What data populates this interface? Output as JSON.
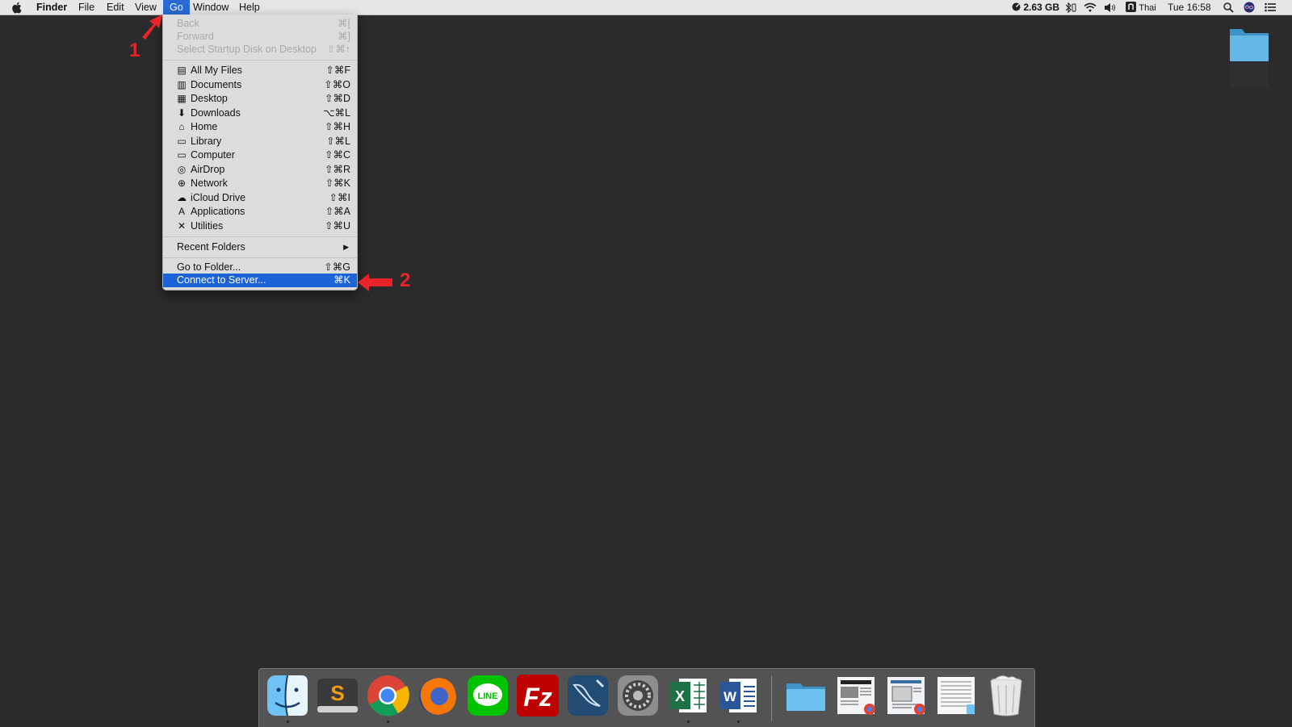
{
  "menubar": {
    "apple_icon": "apple-logo-icon",
    "app_name": "Finder",
    "items": [
      "File",
      "Edit",
      "View",
      "Go",
      "Window",
      "Help"
    ],
    "active_item": "Go",
    "status": {
      "memory": "2.63 GB",
      "input_source": "Thai",
      "clock": "Tue 16:58"
    }
  },
  "go_menu": {
    "nav": [
      {
        "label": "Back",
        "shortcut": "⌘[",
        "enabled": false
      },
      {
        "label": "Forward",
        "shortcut": "⌘]",
        "enabled": false
      },
      {
        "label": "Select Startup Disk on Desktop",
        "shortcut": "⇧⌘↑",
        "enabled": false
      }
    ],
    "places": [
      {
        "label": "All My Files",
        "shortcut": "⇧⌘F",
        "icon": "all-files-icon"
      },
      {
        "label": "Documents",
        "shortcut": "⇧⌘O",
        "icon": "documents-icon"
      },
      {
        "label": "Desktop",
        "shortcut": "⇧⌘D",
        "icon": "desktop-icon"
      },
      {
        "label": "Downloads",
        "shortcut": "⌥⌘L",
        "icon": "downloads-icon"
      },
      {
        "label": "Home",
        "shortcut": "⇧⌘H",
        "icon": "home-icon"
      },
      {
        "label": "Library",
        "shortcut": "⇧⌘L",
        "icon": "library-icon"
      },
      {
        "label": "Computer",
        "shortcut": "⇧⌘C",
        "icon": "computer-icon"
      },
      {
        "label": "AirDrop",
        "shortcut": "⇧⌘R",
        "icon": "airdrop-icon"
      },
      {
        "label": "Network",
        "shortcut": "⇧⌘K",
        "icon": "network-icon"
      },
      {
        "label": "iCloud Drive",
        "shortcut": "⇧⌘I",
        "icon": "icloud-icon"
      },
      {
        "label": "Applications",
        "shortcut": "⇧⌘A",
        "icon": "applications-icon"
      },
      {
        "label": "Utilities",
        "shortcut": "⇧⌘U",
        "icon": "utilities-icon"
      }
    ],
    "recent_folders": "Recent Folders",
    "go_to_folder": {
      "label": "Go to Folder...",
      "shortcut": "⇧⌘G"
    },
    "connect_to_server": {
      "label": "Connect to Server...",
      "shortcut": "⌘K"
    }
  },
  "annotations": {
    "step1": "1",
    "step2": "2"
  },
  "dock": {
    "apps": [
      "finder-icon",
      "sublime-text-icon",
      "chrome-icon",
      "firefox-icon",
      "line-icon",
      "filezilla-icon",
      "mysql-workbench-icon",
      "system-preferences-icon",
      "excel-icon",
      "word-icon"
    ],
    "others": [
      "folder-icon",
      "document-stack-icon",
      "document-stack-icon",
      "document-stack-icon",
      "trash-icon"
    ]
  },
  "colors": {
    "selection": "#1d63d8",
    "annotation": "#e8242a",
    "desktop": "#2b2b2b"
  }
}
